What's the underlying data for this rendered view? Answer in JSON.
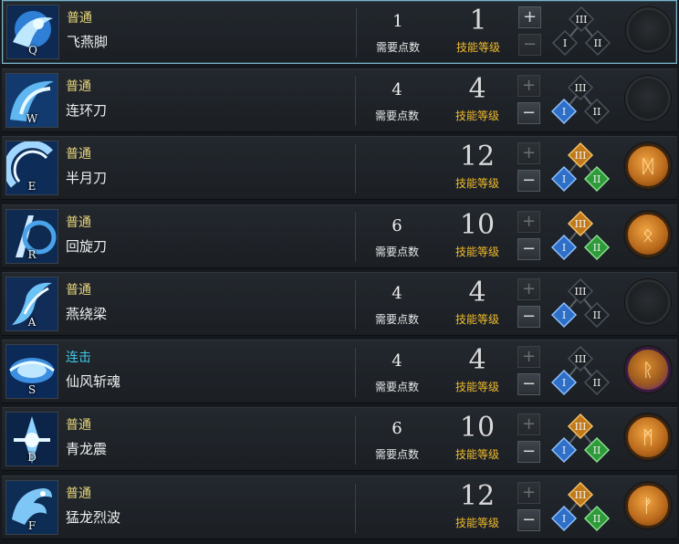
{
  "labels": {
    "points": "需要点数",
    "level": "技能等级",
    "plus": "+",
    "minus": "−"
  },
  "skills": [
    {
      "hotkey": "Q",
      "type": "普通",
      "name": "飞燕脚",
      "points": "1",
      "level": "1",
      "plus_enabled": true,
      "minus_enabled": false,
      "tree": {
        "I": false,
        "II": false,
        "III": false
      },
      "gem": "empty",
      "gem_symbol": ""
    },
    {
      "hotkey": "W",
      "type": "普通",
      "name": "连环刀",
      "points": "4",
      "level": "4",
      "plus_enabled": false,
      "minus_enabled": true,
      "tree": {
        "I": true,
        "II": false,
        "III": false
      },
      "gem": "empty",
      "gem_symbol": ""
    },
    {
      "hotkey": "E",
      "type": "普通",
      "name": "半月刀",
      "points": "",
      "level": "12",
      "plus_enabled": false,
      "minus_enabled": true,
      "tree": {
        "I": true,
        "II": true,
        "III": true
      },
      "gem": "gold",
      "gem_symbol": "ᛞ"
    },
    {
      "hotkey": "R",
      "type": "普通",
      "name": "回旋刀",
      "points": "6",
      "level": "10",
      "plus_enabled": false,
      "minus_enabled": true,
      "tree": {
        "I": true,
        "II": true,
        "III": true
      },
      "gem": "gold",
      "gem_symbol": "ᛟ"
    },
    {
      "hotkey": "A",
      "type": "普通",
      "name": "燕绕梁",
      "points": "4",
      "level": "4",
      "plus_enabled": false,
      "minus_enabled": true,
      "tree": {
        "I": true,
        "II": false,
        "III": false
      },
      "gem": "empty",
      "gem_symbol": ""
    },
    {
      "hotkey": "S",
      "type": "连击",
      "name": "仙风斩魂",
      "points": "4",
      "level": "4",
      "plus_enabled": false,
      "minus_enabled": true,
      "tree": {
        "I": true,
        "II": false,
        "III": false
      },
      "gem": "purple",
      "gem_symbol": "ᚱ"
    },
    {
      "hotkey": "D",
      "type": "普通",
      "name": "青龙震",
      "points": "6",
      "level": "10",
      "plus_enabled": false,
      "minus_enabled": true,
      "tree": {
        "I": true,
        "II": true,
        "III": true
      },
      "gem": "gold",
      "gem_symbol": "ᛗ"
    },
    {
      "hotkey": "F",
      "type": "普通",
      "name": "猛龙烈波",
      "points": "",
      "level": "12",
      "plus_enabled": false,
      "minus_enabled": true,
      "tree": {
        "I": true,
        "II": true,
        "III": true
      },
      "gem": "gold",
      "gem_symbol": "ᚠ"
    }
  ],
  "colors": {
    "tier_I": "#2e6fc8",
    "tier_II": "#2f9a3a",
    "tier_III": "#c07a1c",
    "locked": "#1c2126",
    "type_normal": "#e8d67a",
    "type_combo": "#3fc8e6",
    "level_label": "#f0bb2b"
  }
}
